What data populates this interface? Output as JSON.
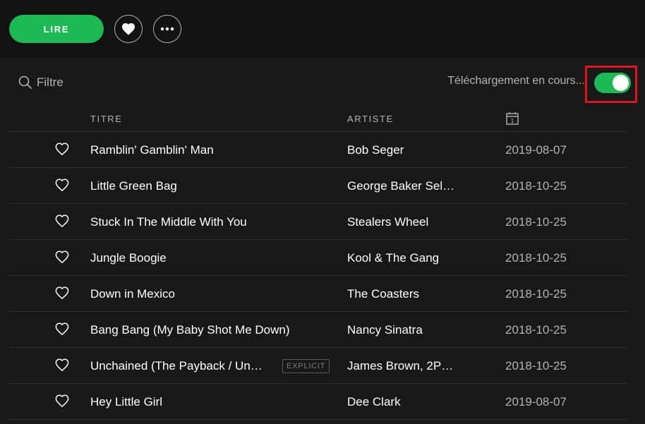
{
  "toolbar": {
    "play_label": "LIRE",
    "like_icon": "heart-icon",
    "more_icon": "more-horizontal-icon"
  },
  "filter": {
    "placeholder": "Filtre",
    "icon": "search-icon"
  },
  "download": {
    "label": "Téléchargement en cours...",
    "toggle_on": true,
    "accent": "#1db954",
    "highlight": "#e0141e"
  },
  "columns": {
    "title": "TITRE",
    "artist": "ARTISTE",
    "date_icon": "calendar-icon"
  },
  "tracks": [
    {
      "title": "Ramblin' Gamblin' Man",
      "artist": "Bob Seger",
      "date": "2019-08-07",
      "explicit": ""
    },
    {
      "title": "Little Green Bag",
      "artist": "George Baker Sel…",
      "date": "2018-10-25",
      "explicit": ""
    },
    {
      "title": "Stuck In The Middle With You",
      "artist": "Stealers Wheel",
      "date": "2018-10-25",
      "explicit": ""
    },
    {
      "title": "Jungle Boogie",
      "artist": "Kool & The Gang",
      "date": "2018-10-25",
      "explicit": ""
    },
    {
      "title": "Down in Mexico",
      "artist": "The Coasters",
      "date": "2018-10-25",
      "explicit": ""
    },
    {
      "title": "Bang Bang (My Baby Shot Me Down)",
      "artist": "Nancy Sinatra",
      "date": "2018-10-25",
      "explicit": ""
    },
    {
      "title": "Unchained (The Payback / Un…",
      "artist": "James Brown, 2P…",
      "date": "2018-10-25",
      "explicit": "EXPLICIT"
    },
    {
      "title": "Hey Little Girl",
      "artist": "Dee Clark",
      "date": "2019-08-07",
      "explicit": ""
    }
  ]
}
